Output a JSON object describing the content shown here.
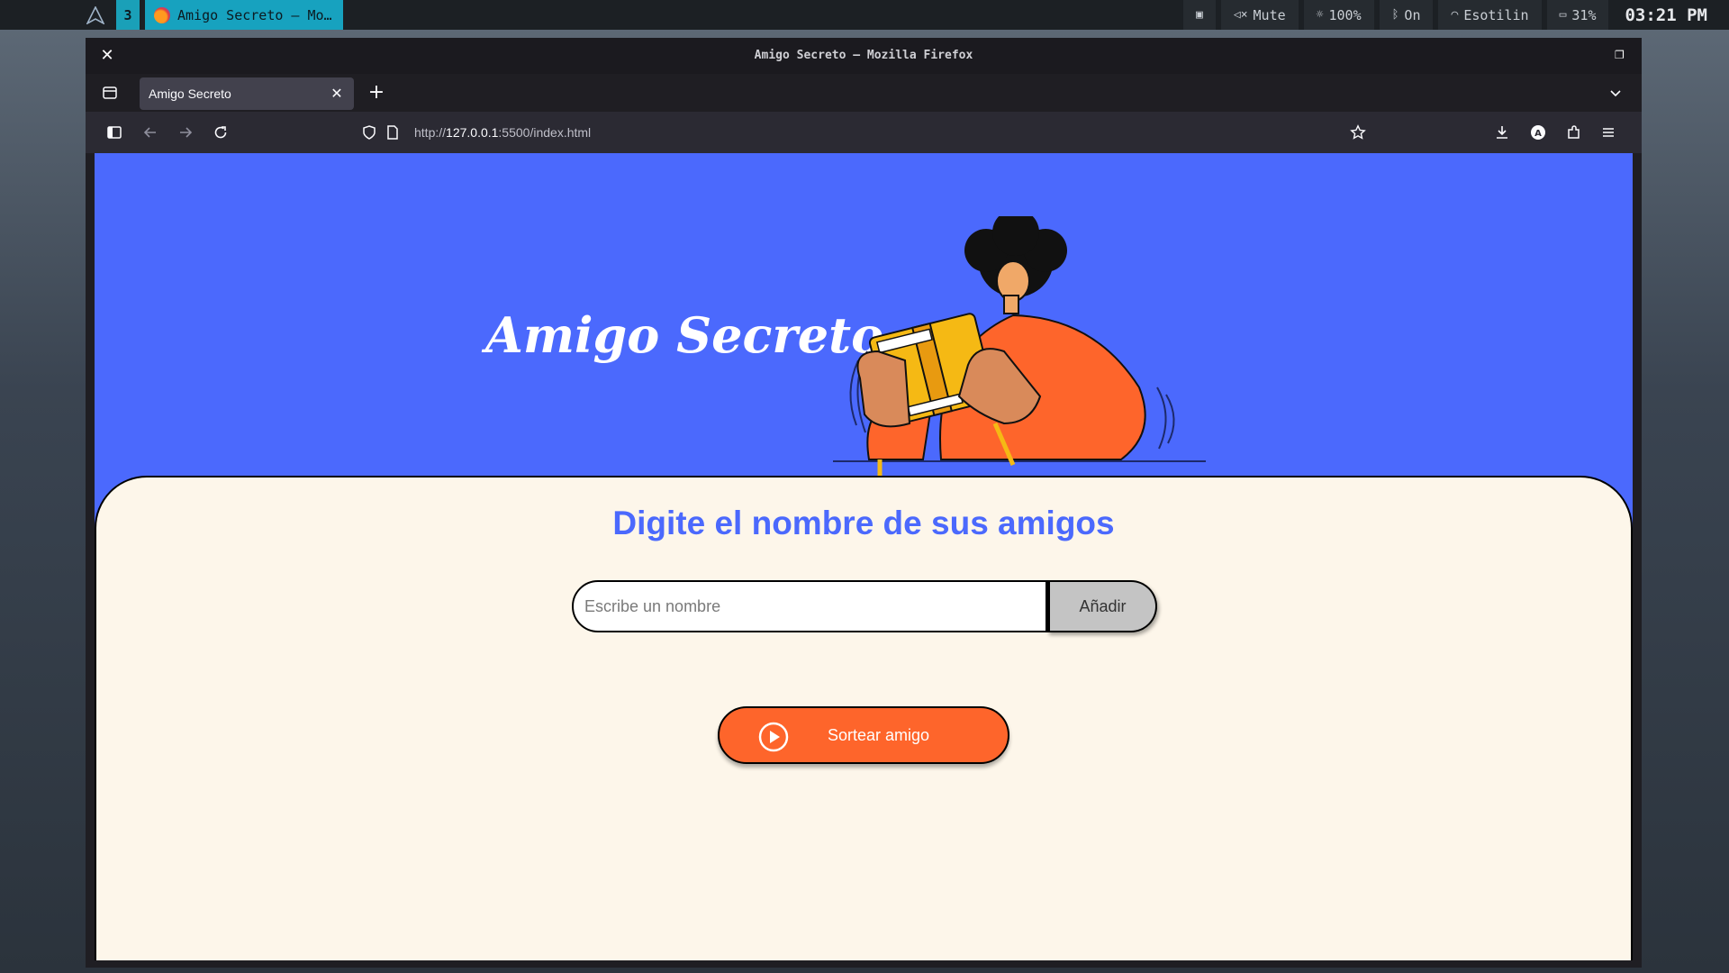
{
  "taskbar": {
    "workspace": "3",
    "active_task": "Amigo Secreto — Mo…",
    "status": {
      "mute": "Mute",
      "brightness": "100%",
      "bluetooth": "On",
      "wifi": "Esotilin",
      "battery": "31%",
      "clock": "03:21 PM"
    }
  },
  "window": {
    "title": "Amigo Secreto — Mozilla Firefox",
    "tab_label": "Amigo Secreto",
    "url_prefix": "http://",
    "url_host": "127.0.0.1",
    "url_rest": ":5500/index.html"
  },
  "page": {
    "hero_title": "Amigo Secreto",
    "heading": "Digite el nombre de sus amigos",
    "input_placeholder": "Escribe un nombre",
    "add_button": "Añadir",
    "draw_button": "Sortear amigo"
  },
  "colors": {
    "hero_bg": "#4b69fd",
    "card_bg": "#fdf6ea",
    "accent_orange": "#fe652b",
    "heading_blue": "#4b69fd"
  }
}
